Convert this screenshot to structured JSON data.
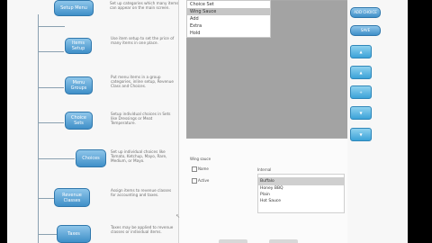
{
  "tree": [
    {
      "label": "Setup Menu",
      "desc": "Set up categories which many items can appear on the main screen."
    },
    {
      "label": "Items Setup",
      "desc": "Use item setup to set the price of many items in one place."
    },
    {
      "label": "Menu Groups",
      "desc": "Put menu items in a group categories, inline setup, Revenue Class and Choices."
    },
    {
      "label": "Choice Sets",
      "desc": "Setup individual choices in Sets like Dressings or Meat Temperature."
    },
    {
      "label": "Choices",
      "desc": "Set up individual choices like Tomato, Ketchup, Mayo, Rare, Medium, or Mayo."
    },
    {
      "label": "Revenue Classes",
      "desc": "Assign items to revenue classes for accounting and taxes."
    },
    {
      "label": "Taxes",
      "desc": "Taxes may be applied to revenue classes or individual items."
    }
  ],
  "main": {
    "list_items": [
      "Choice Set",
      "Wing Sauce",
      "Add",
      "Extra",
      "Hold"
    ],
    "selected_index": 1,
    "section_label": "Wing sauce",
    "checkbox_1": "Name",
    "checkbox_2": "Active",
    "right_label": "Internal",
    "right_items": [
      "Buffalo",
      "Honey BBQ",
      "Plain",
      "Hot Sauce"
    ],
    "right_selected_index": 0
  },
  "sidebar": {
    "btn1": "ADD CHOICE",
    "btn2": "SAVE",
    "arrows": [
      "up-arrow",
      "up-arrow",
      "add",
      "down-arrow",
      "down-arrow"
    ]
  }
}
